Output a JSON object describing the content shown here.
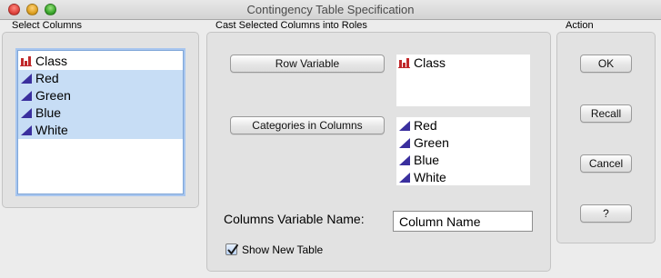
{
  "window": {
    "title": "Contingency Table Specification"
  },
  "select_columns": {
    "caption": "Select Columns",
    "items": [
      {
        "label": "Class",
        "icon": "nominal-bar-icon",
        "selected": false
      },
      {
        "label": "Red",
        "icon": "continuous-triangle-icon",
        "selected": true
      },
      {
        "label": "Green",
        "icon": "continuous-triangle-icon",
        "selected": true
      },
      {
        "label": "Blue",
        "icon": "continuous-triangle-icon",
        "selected": true
      },
      {
        "label": "White",
        "icon": "continuous-triangle-icon",
        "selected": true
      }
    ]
  },
  "roles": {
    "caption": "Cast Selected Columns into Roles",
    "row_variable_button": "Row Variable",
    "row_variable_items": [
      {
        "label": "Class",
        "icon": "nominal-bar-icon"
      }
    ],
    "categories_button": "Categories in Columns",
    "categories_items": [
      {
        "label": "Red",
        "icon": "continuous-triangle-icon"
      },
      {
        "label": "Green",
        "icon": "continuous-triangle-icon"
      },
      {
        "label": "Blue",
        "icon": "continuous-triangle-icon"
      },
      {
        "label": "White",
        "icon": "continuous-triangle-icon"
      }
    ],
    "columns_variable_name_label": "Columns Variable Name:",
    "columns_variable_name_value": "Column Name",
    "show_new_table_label": "Show New Table",
    "show_new_table_checked": true
  },
  "action": {
    "caption": "Action",
    "ok": "OK",
    "recall": "Recall",
    "cancel": "Cancel",
    "help": "?"
  },
  "colors": {
    "selection": "#c7ddf5",
    "nominal_icon": "#c0282a",
    "continuous_icon": "#3a2f9e"
  }
}
